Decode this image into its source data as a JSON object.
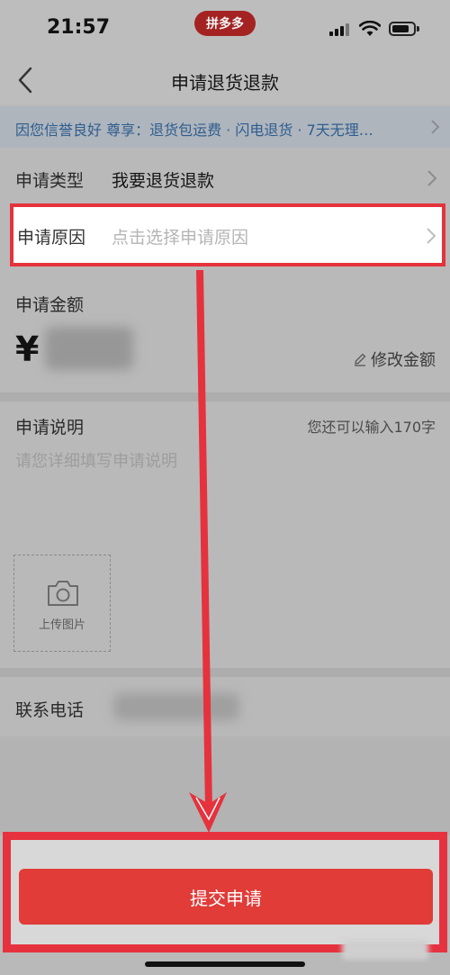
{
  "status_bar": {
    "time": "21:57",
    "app_badge": "拼多多",
    "icons": [
      "signal-icon",
      "wifi-icon",
      "battery-icon"
    ]
  },
  "nav": {
    "title": "申请退货退款",
    "back_icon": "chevron-left-icon"
  },
  "banner": {
    "text": "因您信誉良好 尊享：退货包运费 · 闪电退货 · 7天无理…",
    "text_color": "#2f5d8f"
  },
  "form": {
    "type": {
      "label": "申请类型",
      "value": "我要退货退款"
    },
    "reason": {
      "label": "申请原因",
      "placeholder": "点击选择申请原因"
    },
    "amount": {
      "label": "申请金额",
      "currency": "¥",
      "edit_label": "修改金额"
    },
    "description": {
      "label": "申请说明",
      "counter": "您还可以输入170字",
      "placeholder": "请您详细填写申请说明",
      "upload_label": "上传图片"
    },
    "phone": {
      "label": "联系电话"
    }
  },
  "submit": {
    "label": "提交申请",
    "color": "#e13c38"
  },
  "highlight_color": "#e5323d"
}
